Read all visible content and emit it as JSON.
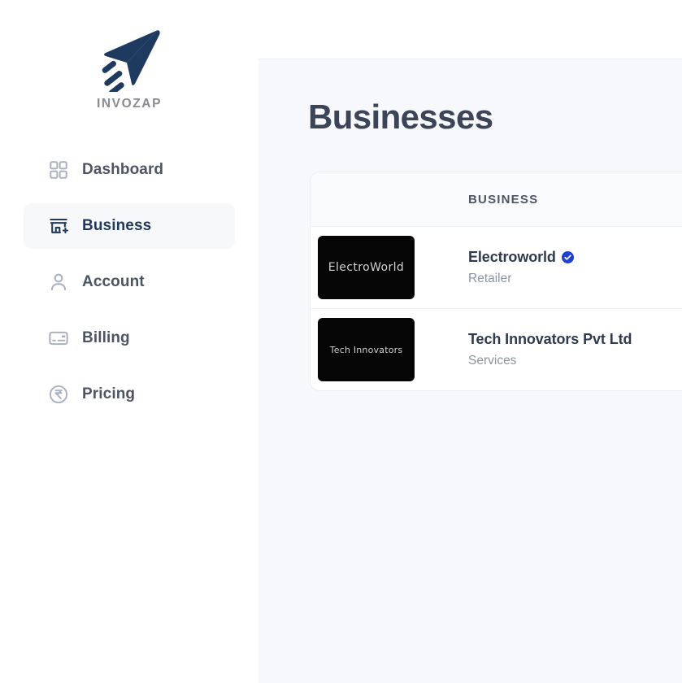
{
  "brand": {
    "name": "INVOZAP",
    "logo_icon": "paper-plane-icon",
    "logo_color": "#1f3a5f"
  },
  "sidebar": {
    "items": [
      {
        "label": "Dashboard",
        "icon": "grid-icon",
        "active": false
      },
      {
        "label": "Business",
        "icon": "storefront-plus-icon",
        "active": true
      },
      {
        "label": "Account",
        "icon": "user-icon",
        "active": false
      },
      {
        "label": "Billing",
        "icon": "credit-card-icon",
        "active": false
      },
      {
        "label": "Pricing",
        "icon": "rupee-circle-icon",
        "active": false
      }
    ]
  },
  "main": {
    "page_title": "Businesses",
    "table": {
      "columns": [
        "BUSINESS"
      ],
      "rows": [
        {
          "logo_text": "ElectroWorld",
          "name": "Electroworld",
          "category": "Retailer",
          "verified": true,
          "verified_badge_color": "#1d3fd6"
        },
        {
          "logo_text": "Tech Innovators",
          "name": "Tech Innovators Pvt Ltd",
          "category": "Services",
          "verified": false
        }
      ]
    }
  },
  "colors": {
    "accent": "#23395b",
    "content_bg": "#f7f8fb",
    "active_nav_bg": "#f6f8fa",
    "badge_blue": "#1d3fd6"
  }
}
